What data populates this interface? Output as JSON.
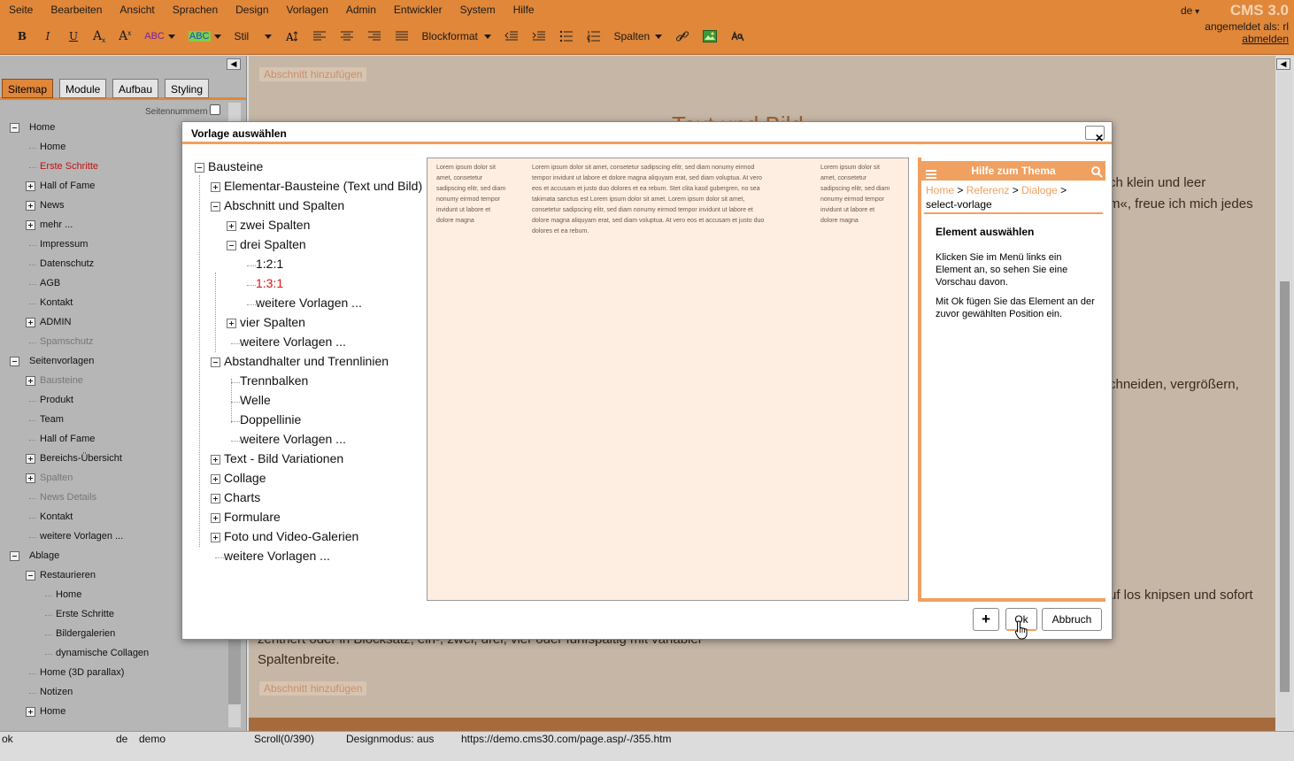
{
  "menu": [
    "Seite",
    "Bearbeiten",
    "Ansicht",
    "Sprachen",
    "Design",
    "Vorlagen",
    "Admin",
    "Entwickler",
    "System",
    "Hilfe"
  ],
  "toolbar": {
    "bold": "B",
    "italic": "I",
    "underline": "U",
    "subscript": "A",
    "superscript": "A",
    "text_color": "ABC",
    "bg_color": "ABC",
    "style_label": "Stil",
    "blockformat_label": "Blockformat",
    "spalten_label": "Spalten"
  },
  "header": {
    "language": "de",
    "brand": "CMS 3.0",
    "logged_in": "angemeldet als: rl",
    "logout": "abmelden"
  },
  "left_panel": {
    "tabs": [
      "Sitemap",
      "Module",
      "Aufbau",
      "Styling"
    ],
    "page_numbers_label": "Seitennummern",
    "tree": [
      {
        "label": "Home",
        "state": "normal"
      },
      {
        "label": "Home",
        "state": "normal"
      },
      {
        "label": "Erste Schritte",
        "state": "active"
      },
      {
        "label": "Hall of Fame",
        "state": "normal"
      },
      {
        "label": "News",
        "state": "normal"
      },
      {
        "label": "mehr ...",
        "state": "normal"
      },
      {
        "label": "Impressum",
        "state": "normal"
      },
      {
        "label": "Datenschutz",
        "state": "normal"
      },
      {
        "label": "AGB",
        "state": "normal"
      },
      {
        "label": "Kontakt",
        "state": "normal"
      },
      {
        "label": "ADMIN",
        "state": "normal"
      },
      {
        "label": "Spamschutz",
        "state": "hidden"
      },
      {
        "label": "Seitenvorlagen",
        "state": "normal"
      },
      {
        "label": "Bausteine",
        "state": "hidden"
      },
      {
        "label": "Produkt",
        "state": "normal"
      },
      {
        "label": "Team",
        "state": "normal"
      },
      {
        "label": "Hall of Fame",
        "state": "normal"
      },
      {
        "label": "Bereichs-Übersicht",
        "state": "normal"
      },
      {
        "label": "Spalten",
        "state": "hidden"
      },
      {
        "label": "News Details",
        "state": "hidden"
      },
      {
        "label": "Kontakt",
        "state": "normal"
      },
      {
        "label": "weitere Vorlagen ...",
        "state": "normal"
      },
      {
        "label": "Ablage",
        "state": "normal"
      },
      {
        "label": "Restaurieren",
        "state": "normal"
      },
      {
        "label": "Home",
        "state": "normal"
      },
      {
        "label": "Erste Schritte",
        "state": "normal"
      },
      {
        "label": "Bildergalerien",
        "state": "normal"
      },
      {
        "label": "dynamische Collagen",
        "state": "normal"
      },
      {
        "label": "Home (3D parallax)",
        "state": "normal"
      },
      {
        "label": "Notizen",
        "state": "normal"
      },
      {
        "label": "Home",
        "state": "normal"
      }
    ]
  },
  "content": {
    "add_section": "Abschnitt hinzufügen",
    "heading_fragment": "Text und Bild",
    "line1": "ch klein und leer",
    "line2": "m«, freue ich mich jedes",
    "line3": "chneiden, vergrößern,",
    "line4": "uf los knipsen und sofort",
    "line5": "zentriert oder in Blocksatz, ein-, zwei, drei, vier oder fünfspaltig mit variabler",
    "line6": "Spaltenbreite."
  },
  "modal": {
    "title": "Vorlage auswählen",
    "close": "✕",
    "tree": [
      {
        "label": "Bausteine",
        "state": "normal"
      },
      {
        "label": "Elementar-Bausteine (Text und Bild)",
        "state": "normal"
      },
      {
        "label": "Abschnitt und Spalten",
        "state": "normal"
      },
      {
        "label": "zwei Spalten",
        "state": "normal"
      },
      {
        "label": "drei Spalten",
        "state": "normal"
      },
      {
        "label": "1:2:1",
        "state": "normal"
      },
      {
        "label": "1:3:1",
        "state": "selected"
      },
      {
        "label": "weitere Vorlagen ...",
        "state": "normal"
      },
      {
        "label": "vier Spalten",
        "state": "normal"
      },
      {
        "label": "weitere Vorlagen ...",
        "state": "normal"
      },
      {
        "label": "Abstandhalter und Trennlinien",
        "state": "normal"
      },
      {
        "label": "Trennbalken",
        "state": "normal"
      },
      {
        "label": "Welle",
        "state": "normal"
      },
      {
        "label": "Doppellinie",
        "state": "normal"
      },
      {
        "label": "weitere Vorlagen ...",
        "state": "normal"
      },
      {
        "label": "Text - Bild Variationen",
        "state": "normal"
      },
      {
        "label": "Collage",
        "state": "normal"
      },
      {
        "label": "Charts",
        "state": "normal"
      },
      {
        "label": "Formulare",
        "state": "normal"
      },
      {
        "label": "Foto und Video-Galerien",
        "state": "normal"
      },
      {
        "label": "weitere Vorlagen ...",
        "state": "normal"
      }
    ],
    "preview": {
      "col1": [
        "Lorem ipsum dolor sit",
        "amet, consetetur",
        "sadipscing elitr, sed diam",
        "nonumy eirmod tempor",
        "invidunt ut labore et",
        "dolore magna"
      ],
      "col2": [
        "Lorem ipsum dolor sit amet, consetetur sadipscing elitr, sed diam nonumy eirmod",
        "tempor invidunt ut labore et dolore magna aliquyam erat, sed diam voluptua. At vero",
        "eos et accusam et justo duo dolores et ea rebum. Stet clita kasd gubergren, no sea",
        "takimata sanctus est Lorem ipsum dolor sit amet. Lorem ipsum dolor sit amet,",
        "consetetur sadipscing elitr, sed diam nonumy eirmod tempor invidunt ut labore et",
        "dolore magna aliquyam erat, sed diam voluptua. At vero eos et accusam et justo duo",
        "dolores et ea rebum."
      ],
      "col3": [
        "Lorem ipsum dolor sit",
        "amet, consetetur",
        "sadipscing elitr, sed diam",
        "nonumy eirmod tempor",
        "invidunt ut labore et",
        "dolore magna"
      ]
    },
    "help": {
      "title": "Hilfe zum Thema",
      "breadcrumb": [
        "Home",
        "Referenz",
        "Dialoge"
      ],
      "breadcrumb_sep": ">",
      "current": "select-vorlage",
      "heading": "Element auswählen",
      "p1": "Klicken Sie im Menü links ein Element an, so sehen Sie eine Vorschau davon.",
      "p2": "Mit Ok fügen Sie das Element an der zuvor gewählten Position ein."
    },
    "buttons": {
      "plus": "+",
      "ok": "Ok",
      "cancel": "Abbruch"
    }
  },
  "status": {
    "ok": "ok",
    "lang": "de",
    "user": "demo",
    "scroll": "Scroll(0/390)",
    "design_mode": "Designmodus: aus",
    "url": "https://demo.cms30.com/page.asp/-/355.htm"
  },
  "colors": {
    "accent": "#e0873a",
    "help_accent": "#f0a060",
    "active_link": "#c21010",
    "selected": "#e01010"
  }
}
